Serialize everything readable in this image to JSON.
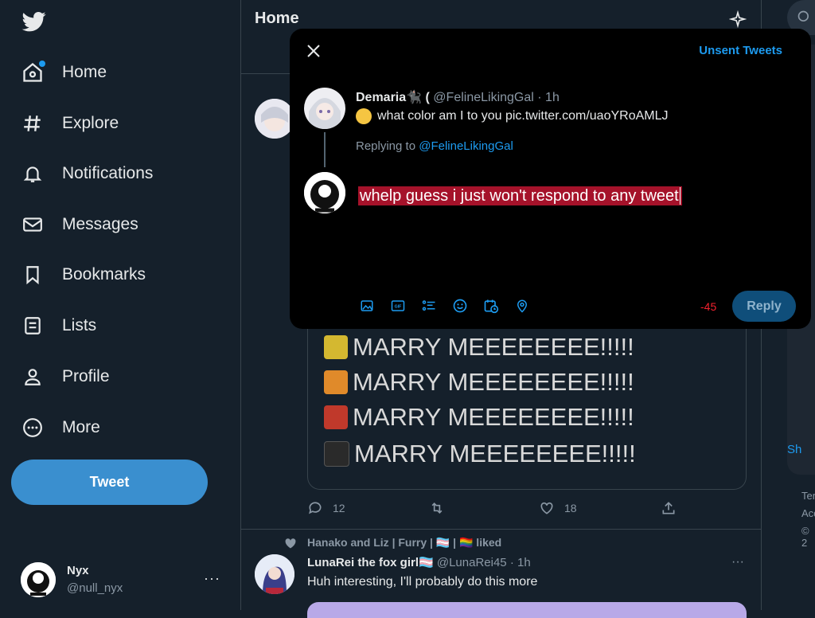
{
  "colors": {
    "accent": "#1d9bf0",
    "background": "#15202b",
    "modal": "#000000",
    "highlight": "#a5122a",
    "overLimit": "#f4212e"
  },
  "nav": {
    "items": [
      {
        "label": "Home",
        "icon": "home-icon"
      },
      {
        "label": "Explore",
        "icon": "hashtag-icon"
      },
      {
        "label": "Notifications",
        "icon": "bell-icon"
      },
      {
        "label": "Messages",
        "icon": "mail-icon"
      },
      {
        "label": "Bookmarks",
        "icon": "bookmark-icon"
      },
      {
        "label": "Lists",
        "icon": "list-icon"
      },
      {
        "label": "Profile",
        "icon": "person-icon"
      },
      {
        "label": "More",
        "icon": "more-circle-icon"
      }
    ],
    "tweet_button": "Tweet"
  },
  "account": {
    "name": "Nyx",
    "handle": "@null_nyx",
    "more": "···"
  },
  "feed": {
    "title": "Home",
    "media_lines": [
      "MARRY MEEEEEEEE!!!!!",
      "MARRY MEEEEEEEE!!!!!",
      "MARRY MEEEEEEEE!!!!!",
      "MARRY MEEEEEEEE!!!!!"
    ],
    "media_colors": [
      "#d4b830",
      "#e08a2a",
      "#c0392b",
      "#2a2a2a"
    ],
    "actions": {
      "replies": "12",
      "likes": "18"
    },
    "second_tweet": {
      "liked_by": "Hanako and Liz | Furry | 🏳️‍⚧️ | 🏳️‍🌈 liked",
      "name": "LunaRei the fox girl🏳️‍⚧️",
      "handle": "@LunaRei45",
      "time": "· 1h",
      "text": "Huh interesting, I'll probably do this more"
    }
  },
  "modal": {
    "unsent_tweets": "Unsent Tweets",
    "original": {
      "name": "Demaria🐈‍⬛ (",
      "handle": "@FelineLikingGal",
      "time": "· 1h",
      "text": "what color am I to you pic.twitter.com/uaoYRoAMLJ"
    },
    "replying_prefix": "Replying to",
    "replying_to": "@FelineLikingGal",
    "draft": "whelp guess i just won't respond to any tweet",
    "char_count": "-45",
    "reply_button": "Reply"
  },
  "right": {
    "footer": [
      "Ter",
      "Acc",
      "© 2"
    ],
    "show_more": "Sh"
  }
}
